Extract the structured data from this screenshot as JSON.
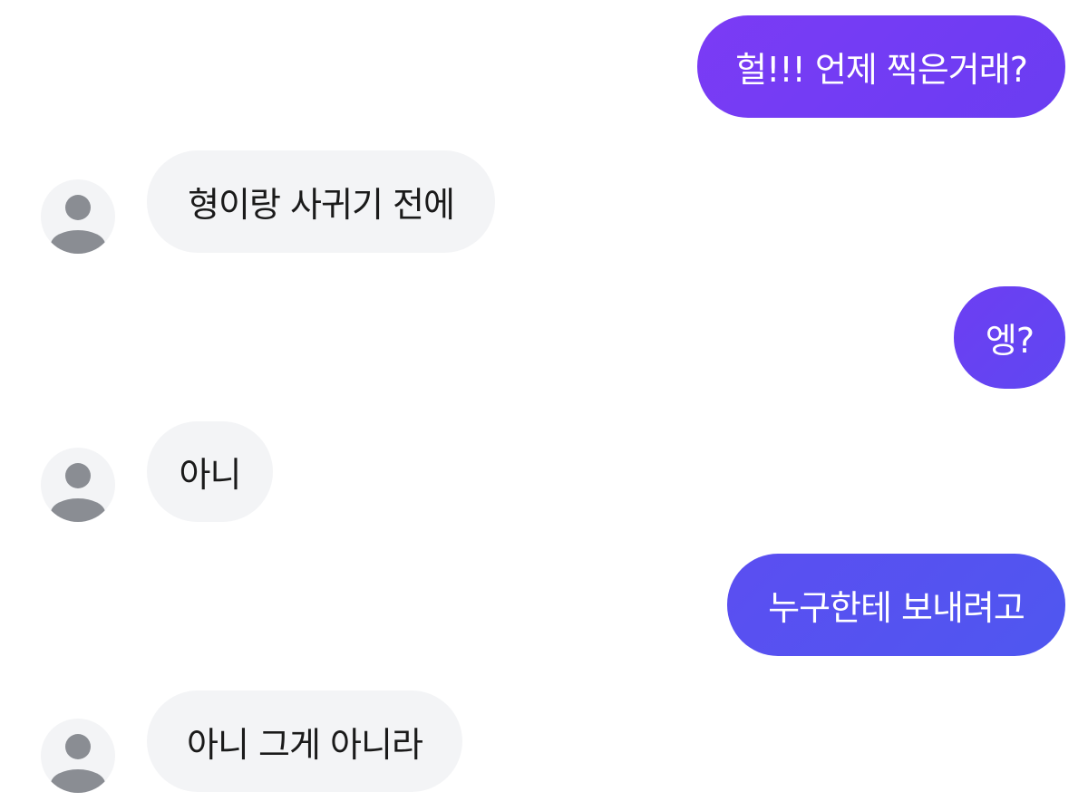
{
  "conversation": {
    "messages": [
      {
        "direction": "outgoing",
        "text": "헐!!! 언제 찍은거래?"
      },
      {
        "direction": "incoming",
        "text": "형이랑 사귀기 전에"
      },
      {
        "direction": "outgoing",
        "text": "엥?"
      },
      {
        "direction": "incoming",
        "text": "아니"
      },
      {
        "direction": "outgoing",
        "text": "누구한테 보내려고"
      },
      {
        "direction": "incoming",
        "text": "아니 그게 아니라"
      }
    ]
  },
  "icons": {
    "avatar": "default-user-avatar-icon"
  },
  "colors": {
    "outgoing_bubble_start": "#7b3bf5",
    "outgoing_bubble_end": "#4f57f0",
    "incoming_bubble": "#f3f4f6",
    "avatar_background": "#f3f4f6",
    "avatar_figure": "#8a8d93"
  }
}
